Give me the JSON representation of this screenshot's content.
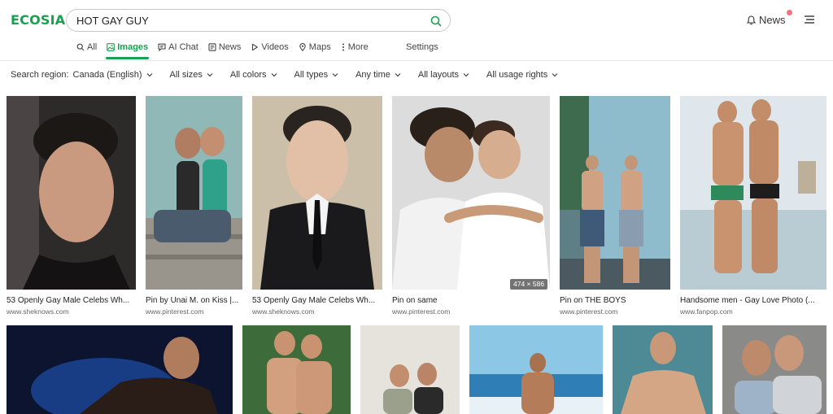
{
  "brand": {
    "logo": "ECOSIA",
    "accent_color": "#19a051"
  },
  "search": {
    "value": "HOT GAY GUY",
    "button_icon": "search-icon"
  },
  "header": {
    "news_label": "News",
    "news_icon": "bell-icon",
    "menu_icon": "hamburger-icon"
  },
  "tabs": [
    {
      "label": "All",
      "icon": "search-icon",
      "active": false
    },
    {
      "label": "Images",
      "icon": "image-icon",
      "active": true
    },
    {
      "label": "AI Chat",
      "icon": "chat-icon",
      "active": false
    },
    {
      "label": "News",
      "icon": "newspaper-icon",
      "active": false
    },
    {
      "label": "Videos",
      "icon": "play-icon",
      "active": false
    },
    {
      "label": "Maps",
      "icon": "map-pin-icon",
      "active": false
    },
    {
      "label": "More",
      "icon": "more-vertical-icon",
      "active": false
    }
  ],
  "settings_label": "Settings",
  "filters": {
    "region_label": "Search region:",
    "region_value": "Canada (English)",
    "items": [
      "All sizes",
      "All colors",
      "All types",
      "Any time",
      "All layouts",
      "All usage rights"
    ]
  },
  "results": [
    {
      "caption": "53 Openly Gay Male Celebs Wh...",
      "source": "www.sheknows.com"
    },
    {
      "caption": "Pin by Unai M. on Kiss |...",
      "source": "www.pinterest.com"
    },
    {
      "caption": "53 Openly Gay Male Celebs Wh...",
      "source": "www.sheknows.com"
    },
    {
      "caption": "Pin on same",
      "source": "www.pinterest.com",
      "dimensions": "474 × 586"
    },
    {
      "caption": "Pin on THE BOYS",
      "source": "www.pinterest.com"
    },
    {
      "caption": "Handsome men - Gay Love Photo (...",
      "source": "www.fanpop.com"
    }
  ]
}
